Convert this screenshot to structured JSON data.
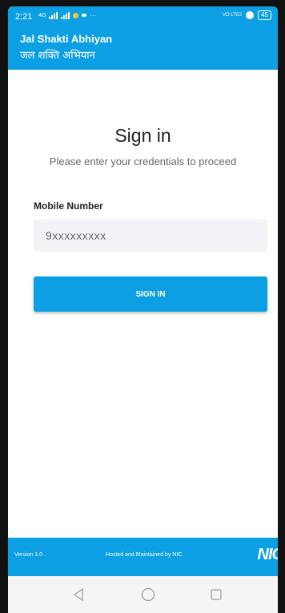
{
  "status_bar": {
    "time": "2:21",
    "network_left": "4G",
    "network_right": "VO LTE2",
    "battery": "45"
  },
  "header": {
    "title": "Jal Shakti Abhiyan",
    "subtitle": "जल शक्ति अभियान",
    "color": "#0d9fe3"
  },
  "signin": {
    "title": "Sign in",
    "subtitle": "Please enter your credentials to proceed",
    "mobile_label": "Mobile Number",
    "mobile_placeholder": "9xxxxxxxxx",
    "mobile_value": "",
    "button_label": "SIGN IN"
  },
  "footer": {
    "version": "Version 1.0",
    "hosted": "Hosted and Maintained by NIC",
    "logo": "NIC"
  },
  "nav": {
    "back_icon": "back-triangle-icon",
    "home_icon": "home-circle-icon",
    "recents_icon": "recents-square-icon"
  }
}
